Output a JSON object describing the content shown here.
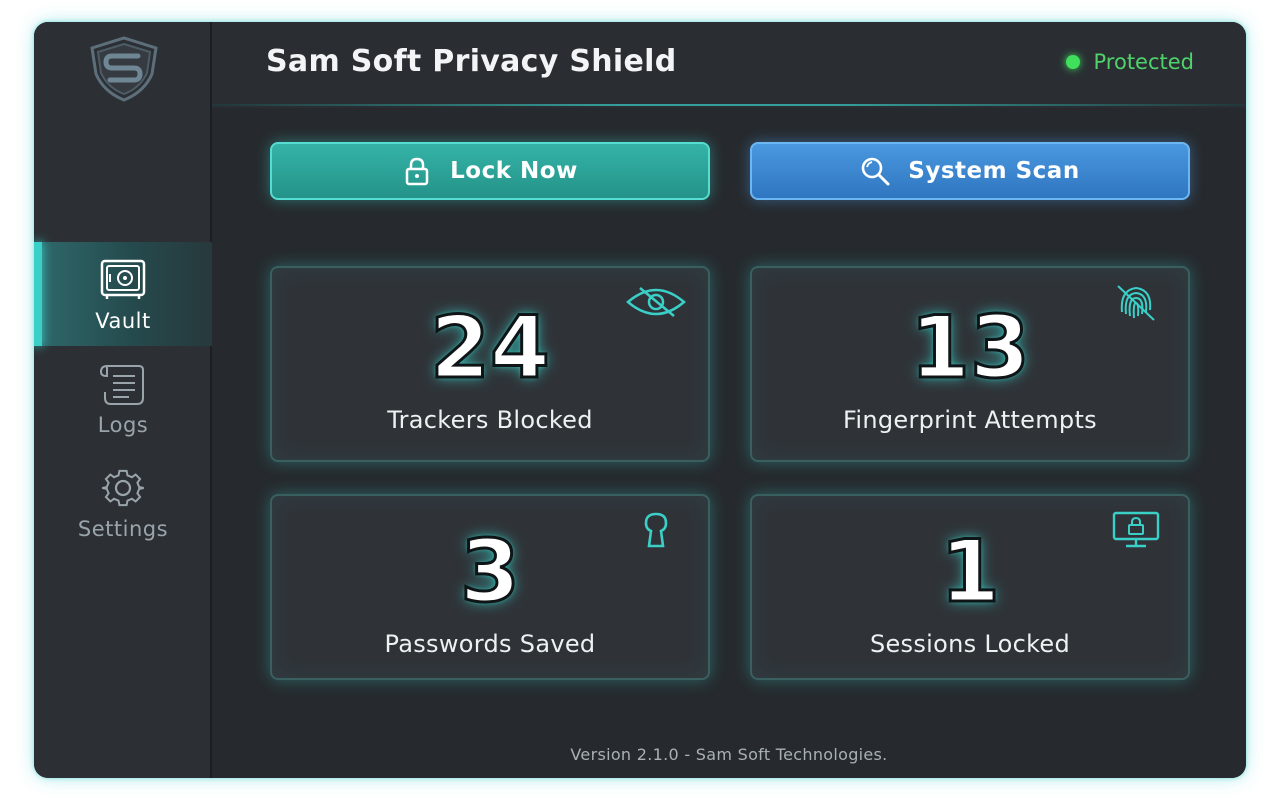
{
  "app": {
    "title": "Sam Soft Privacy Shield",
    "status": "Protected",
    "status_color": "#3fe05c",
    "accent": "#3ad0c8"
  },
  "sidebar": {
    "logo_icon": "shield-s-logo-icon",
    "items": [
      {
        "label": "Vault",
        "icon": "safe-icon",
        "active": true
      },
      {
        "label": "Logs",
        "icon": "scroll-icon",
        "active": false
      },
      {
        "label": "Settings",
        "icon": "gear-icon",
        "active": false
      }
    ]
  },
  "actions": {
    "lock": {
      "label": "Lock Now",
      "icon": "padlock-icon",
      "color": "#2aa197"
    },
    "scan": {
      "label": "System Scan",
      "icon": "search-icon",
      "color": "#3b86d0"
    }
  },
  "stats": [
    {
      "value": "24",
      "label": "Trackers Blocked",
      "icon": "eye-off-icon"
    },
    {
      "value": "13",
      "label": "Fingerprint Attempts",
      "icon": "fingerprint-off-icon"
    },
    {
      "value": "3",
      "label": "Passwords Saved",
      "icon": "keyhole-icon"
    },
    {
      "value": "1",
      "label": "Sessions Locked",
      "icon": "monitor-lock-icon"
    }
  ],
  "footer": {
    "text": "Version 2.1.0 - Sam Soft Technologies."
  }
}
